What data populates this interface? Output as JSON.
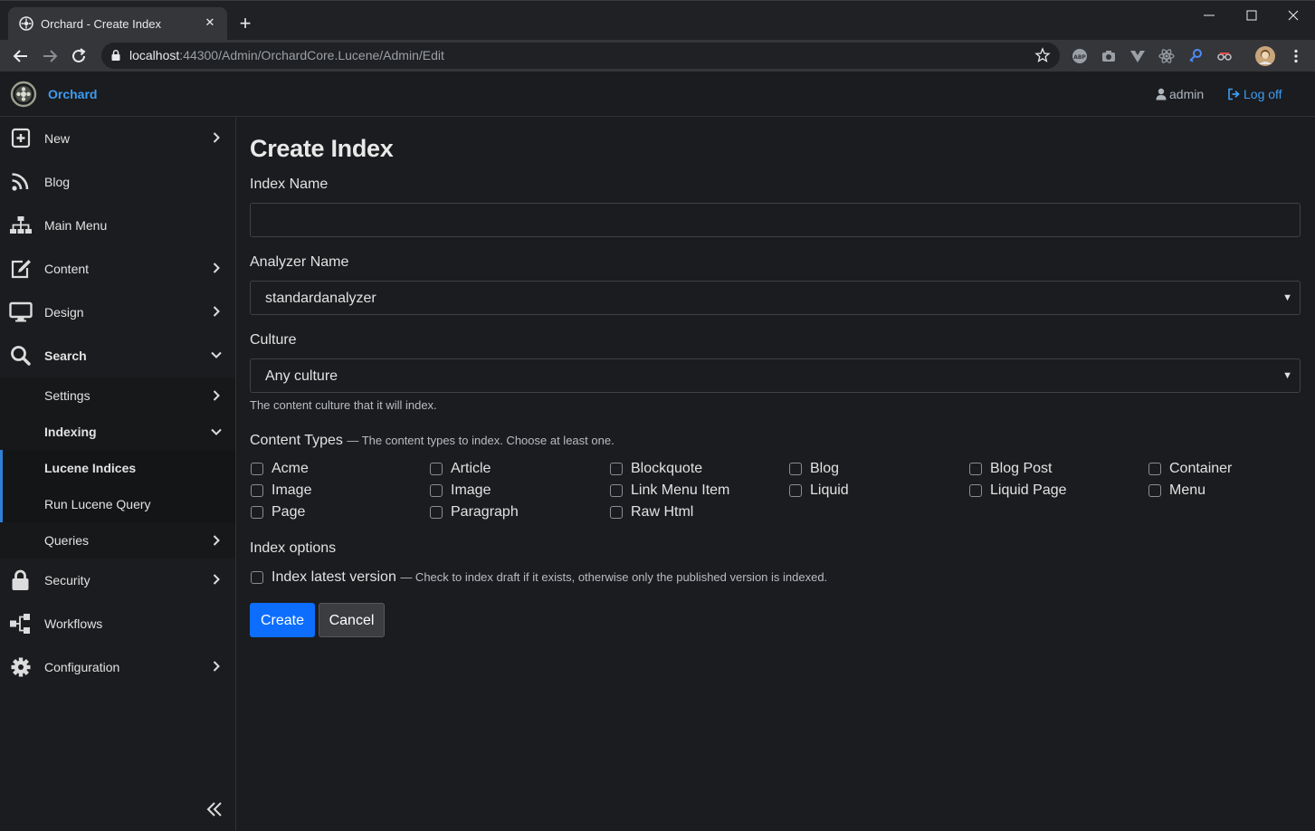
{
  "browser": {
    "tab_title": "Orchard - Create Index",
    "tab_close": "✕",
    "new_tab": "+",
    "window_controls": {
      "minimize": "—",
      "maximize": "☐",
      "close": "✕"
    },
    "url_host": "localhost",
    "url_rest": ":44300/Admin/OrchardCore.Lucene/Admin/Edit",
    "extensions": [
      "abp-icon",
      "camera-icon",
      "vue-icon",
      "react-icon",
      "key-icon",
      "glasses-icon",
      "profile-avatar",
      "kebab-menu-icon"
    ]
  },
  "header": {
    "brand": "Orchard",
    "user": "admin",
    "logoff": "Log off"
  },
  "sidebar": {
    "items": [
      {
        "label": "New",
        "icon": "plus-square-icon",
        "chevron": "right"
      },
      {
        "label": "Blog",
        "icon": "rss-icon",
        "chevron": "none"
      },
      {
        "label": "Main Menu",
        "icon": "sitemap-icon",
        "chevron": "none"
      },
      {
        "label": "Content",
        "icon": "edit-icon",
        "chevron": "right"
      },
      {
        "label": "Design",
        "icon": "desktop-icon",
        "chevron": "right"
      },
      {
        "label": "Search",
        "icon": "search-icon",
        "chevron": "down"
      },
      {
        "label": "Security",
        "icon": "lock-icon",
        "chevron": "right"
      },
      {
        "label": "Workflows",
        "icon": "workflow-icon",
        "chevron": "none"
      },
      {
        "label": "Configuration",
        "icon": "cog-icon",
        "chevron": "right"
      }
    ],
    "search_children": [
      {
        "label": "Settings",
        "chevron": "right"
      },
      {
        "label": "Indexing",
        "chevron": "down"
      },
      {
        "label": "Lucene Indices",
        "chevron": "none"
      },
      {
        "label": "Run Lucene Query",
        "chevron": "none"
      },
      {
        "label": "Queries",
        "chevron": "right"
      }
    ],
    "collapse": "«"
  },
  "form": {
    "title": "Create Index",
    "index_name_label": "Index Name",
    "index_name_value": "",
    "analyzer_label": "Analyzer Name",
    "analyzer_value": "standardanalyzer",
    "culture_label": "Culture",
    "culture_value": "Any culture",
    "culture_hint": "The content culture that it will index.",
    "content_types_label": "Content Types",
    "content_types_hint": "— The content types to index. Choose at least one.",
    "content_types": [
      "Acme",
      "Article",
      "Blockquote",
      "Blog",
      "Blog Post",
      "Container",
      "Image",
      "Image",
      "Link Menu Item",
      "Liquid",
      "Liquid Page",
      "Menu",
      "Page",
      "Paragraph",
      "Raw Html"
    ],
    "index_options_label": "Index options",
    "latest_version_label": "Index latest version",
    "latest_version_hint": "— Check to index draft if it exists, otherwise only the published version is indexed.",
    "create_button": "Create",
    "cancel_button": "Cancel"
  },
  "colors": {
    "accent": "#3d9cf0",
    "primary_button": "#0d6efd",
    "background": "#1b1c1f"
  }
}
